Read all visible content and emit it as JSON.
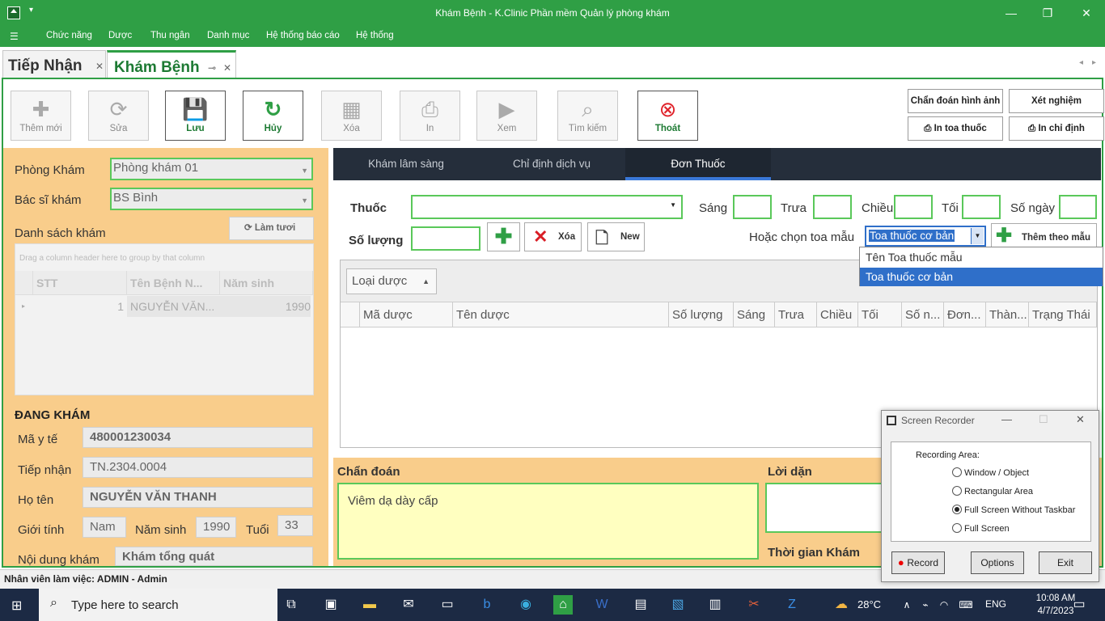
{
  "window": {
    "title": "Khám Bệnh - K.Clinic Phần mềm Quản lý phòng khám",
    "quick_access": "▾"
  },
  "menu": [
    "Chức năng",
    "Dược",
    "Thu ngân",
    "Danh mục",
    "Hệ thống báo cáo",
    "Hệ thống"
  ],
  "doc_tabs": [
    {
      "label": "Tiếp Nhận"
    },
    {
      "label": "Khám Bệnh"
    }
  ],
  "toolbar": {
    "them_moi": "Thêm mới",
    "sua": "Sửa",
    "luu": "Lưu",
    "huy": "Hủy",
    "xoa": "Xóa",
    "in": "In",
    "xem": "Xem",
    "tim_kiem": "Tìm kiếm",
    "thoat": "Thoát",
    "chan_doan_hinh_anh": "Chẩn đoán hình ảnh",
    "xet_nghiem": "Xét nghiệm",
    "in_toa_thuoc": "In toa thuốc",
    "in_chi_dinh": "In chỉ định"
  },
  "left": {
    "phong_kham_label": "Phòng Khám",
    "phong_kham_value": "Phòng khám 01",
    "bac_si_label": "Bác sĩ khám",
    "bac_si_value": "BS Bình",
    "danh_sach_label": "Danh sách khám",
    "lam_tuoi": "Làm tươi",
    "group_hint": "Drag a column header here to group by that column",
    "grid_headers": [
      "STT",
      "Tên Bệnh N...",
      "Năm sinh"
    ],
    "grid_row": {
      "stt": "1",
      "ten": "NGUYỄN VĂN...",
      "nam_sinh": "1990"
    },
    "dang_kham": "ĐANG KHÁM",
    "ma_y_te_label": "Mã y tế",
    "ma_y_te": "480001230034",
    "tiep_nhan_label": "Tiếp nhận",
    "tiep_nhan": "TN.2304.0004",
    "ho_ten_label": "Họ tên",
    "ho_ten": "NGUYỄN VĂN THANH",
    "gioi_tinh_label": "Giới tính",
    "gioi_tinh": "Nam",
    "nam_sinh_label": "Năm sinh",
    "nam_sinh": "1990",
    "tuoi_label": "Tuổi",
    "tuoi": "33",
    "noi_dung_label": "Nội dung khám",
    "noi_dung": "Khám tổng quát"
  },
  "right_tabs": [
    "Khám lâm sàng",
    "Chỉ định dịch vụ",
    "Đơn Thuốc"
  ],
  "don_thuoc": {
    "thuoc_label": "Thuốc",
    "sang_label": "Sáng",
    "trua_label": "Trưa",
    "chieu_label": "Chiều",
    "toi_label": "Tối",
    "so_ngay_label": "Số ngày",
    "so_luong_label": "Số lượng",
    "xoa_btn": "Xóa",
    "new_btn": "New",
    "hoac_chon_label": "Hoặc chọn toa mẫu",
    "combo_value": "Toa thuốc cơ bản",
    "them_theo_mau": "Thêm theo mẫu",
    "dropdown_items": [
      "Tên Toa thuốc mẫu",
      "Toa thuốc cơ bản"
    ],
    "loai_duoc": "Loại dược",
    "columns": [
      "Mã dược",
      "Tên dược",
      "Số lượng",
      "Sáng",
      "Trưa",
      "Chiều",
      "Tối",
      "Số n...",
      "Đơn...",
      "Thàn...",
      "Trạng Thái"
    ]
  },
  "bottom": {
    "chan_doan_label": "Chẩn đoán",
    "chan_doan": "Viêm dạ dày cấp",
    "loi_dan_label": "Lời dặn",
    "thoi_gian_label": "Thời gian Khám"
  },
  "status": "Nhân viên làm việc: ADMIN - Admin",
  "recorder": {
    "title": "Screen Recorder",
    "area_label": "Recording Area:",
    "options": [
      "Window / Object",
      "Rectangular Area",
      "Full Screen Without Taskbar",
      "Full Screen"
    ],
    "selected": "Full Screen Without Taskbar",
    "record": "Record",
    "options_btn": "Options",
    "exit": "Exit"
  },
  "taskbar": {
    "search_placeholder": "Type here to search",
    "weather": "28°C",
    "lang": "ENG",
    "time": "10:08 AM",
    "date": "4/7/2023"
  },
  "colors": {
    "brand_green": "#2f9f45",
    "panel_orange": "#f9cd8b",
    "tab_dark": "#252e3b",
    "select_blue": "#2f6fc9",
    "note_yellow": "#ffffc0"
  }
}
